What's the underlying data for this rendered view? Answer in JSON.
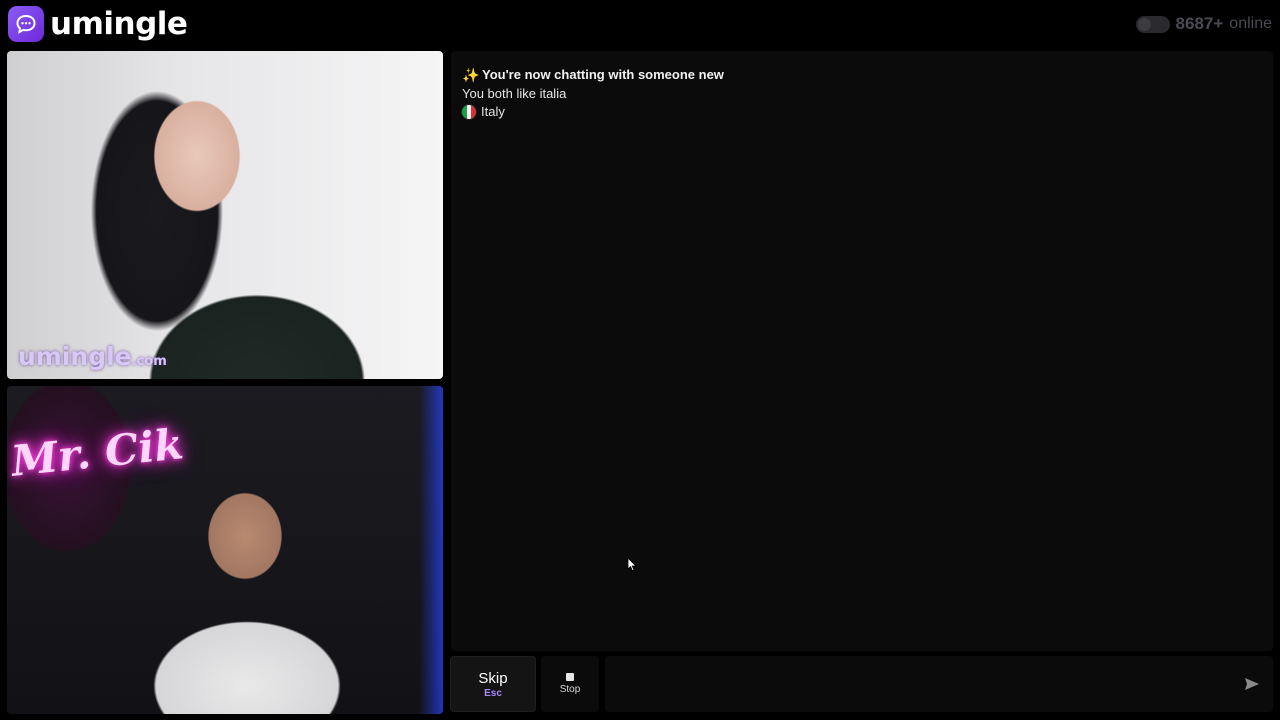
{
  "header": {
    "logo_text": "umingle",
    "online_count": "8687+",
    "online_label": "online"
  },
  "videos": {
    "remote_watermark_main": "umingle",
    "remote_watermark_suffix": ".com",
    "local_neon_text": "Mr. Cik"
  },
  "chat": {
    "headline": "You're now chatting with someone new",
    "interest_line": "You both like italia",
    "country": "Italy",
    "icons": {
      "headline": "sparkle-icon",
      "country": "italy-flag-icon"
    }
  },
  "controls": {
    "skip_label": "Skip",
    "skip_shortcut": "Esc",
    "stop_label": "Stop",
    "message_placeholder": ""
  },
  "colors": {
    "brand": "#7c3aed",
    "accent": "#a78bfa",
    "background": "#000000",
    "panel": "#0b0b0b"
  }
}
